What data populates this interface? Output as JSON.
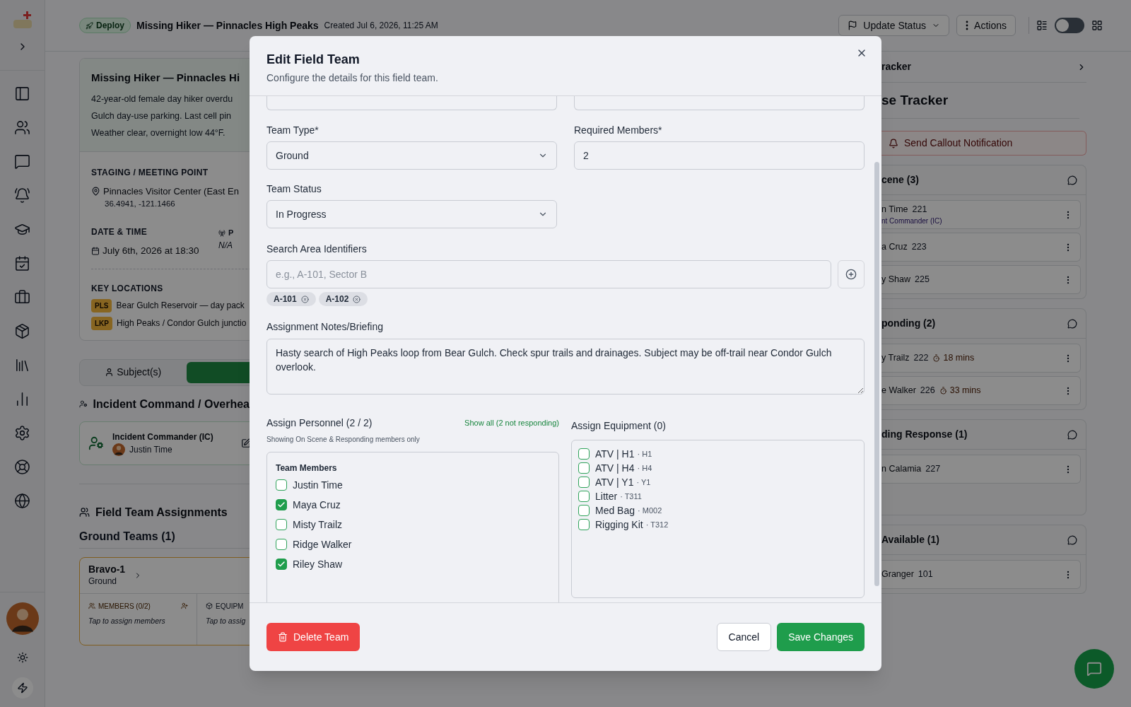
{
  "top_bar": {
    "badge": "Deploy",
    "title": "Missing Hiker — Pinnacles High Peaks",
    "created": "Created Jul 6, 2026, 11:25 AM",
    "update_status": "Update Status",
    "actions": "Actions",
    "view_toggle": {
      "on": false
    }
  },
  "incident": {
    "title": "Missing Hiker — Pinnacles Hi",
    "description_lines": [
      "42-year-old female day hiker overdu",
      "Gulch day-use parking. Last cell pin",
      "Weather clear, overnight low 44°F."
    ],
    "staging_label": "STAGING / MEETING POINT",
    "staging": "Pinnacles Visitor Center (East En",
    "coords": "36.4941, -121.1466",
    "date_label": "DATE & TIME",
    "date": "July 6th, 2026 at 18:30",
    "side_label": "P",
    "side_value": "N/A",
    "key_label": "KEY LOCATIONS",
    "locations": [
      {
        "tag": "PLS",
        "text": "Bear Gulch Reservoir — day pack"
      },
      {
        "tag": "LKP",
        "text": "High Peaks / Condor Gulch junctio"
      }
    ]
  },
  "tabs": [
    {
      "label": "Subject(s)",
      "selected": false
    },
    {
      "selected": true
    }
  ],
  "command": {
    "heading": "Incident Command / Overhea",
    "role": "Incident Commander (IC)",
    "name": "Justin Time"
  },
  "field_teams": {
    "heading": "Field Team Assignments",
    "group": "Ground Teams (1)",
    "team": {
      "name": "Bravo-1",
      "type": "Ground",
      "members_label": "MEMBERS (0/2)",
      "members_hint": "Tap to assign members",
      "equipment_label": "EQUIPM",
      "equipment_hint": "Tap to assig"
    }
  },
  "tracker": {
    "link": "racker",
    "heading": "se Tracker",
    "callout": "Send Callout Notification",
    "groups": [
      {
        "title": "cene (3)",
        "members": [
          {
            "name": "n Time",
            "number": "221",
            "role": "nt Commander (IC)"
          },
          {
            "name": "a Cruz",
            "number": "223"
          },
          {
            "name": "y Shaw",
            "number": "225"
          }
        ]
      },
      {
        "title": "ponding (2)",
        "members": [
          {
            "name": "y Trailz",
            "number": "222",
            "eta": "18 mins"
          },
          {
            "name": "e Walker",
            "number": "226",
            "eta": "33 mins"
          }
        ]
      },
      {
        "title": "ding Response (1)",
        "members": [
          {
            "name": "n Calamia",
            "number": "227"
          }
        ]
      },
      {
        "title": "Available (1)",
        "members": [
          {
            "name": "Granger",
            "number": "101"
          }
        ]
      }
    ]
  },
  "modal": {
    "title": "Edit Field Team",
    "subtitle": "Configure the details for this field team.",
    "team_type": {
      "label": "Team Type*",
      "value": "Ground"
    },
    "required_members": {
      "label": "Required Members*",
      "value": "2"
    },
    "team_status": {
      "label": "Team Status",
      "value": "In Progress"
    },
    "search_area": {
      "label": "Search Area Identifiers",
      "placeholder": "e.g., A-101, Sector B",
      "tags": [
        "A-101",
        "A-102"
      ]
    },
    "notes": {
      "label": "Assignment Notes/Briefing",
      "value": "Hasty search of High Peaks loop from Bear Gulch. Check spur trails and drainages. Subject may be off-trail near Condor Gulch overlook."
    },
    "personnel": {
      "label": "Assign Personnel (2 / 2)",
      "show_all": "Show all (2 not responding)",
      "hint": "Showing On Scene & Responding members only",
      "group": "Team Members",
      "members": [
        {
          "name": "Justin Time",
          "checked": false
        },
        {
          "name": "Maya Cruz",
          "checked": true
        },
        {
          "name": "Misty Trailz",
          "checked": false
        },
        {
          "name": "Ridge Walker",
          "checked": false
        },
        {
          "name": "Riley Shaw",
          "checked": true
        }
      ]
    },
    "equipment": {
      "label": "Assign Equipment (0)",
      "items": [
        {
          "name": "ATV | H1",
          "code": "· H1",
          "checked": false
        },
        {
          "name": "ATV | H4",
          "code": "· H4",
          "checked": false
        },
        {
          "name": "ATV | Y1",
          "code": "· Y1",
          "checked": false
        },
        {
          "name": "Litter",
          "code": "· T311",
          "checked": false
        },
        {
          "name": "Med Bag",
          "code": "· M002",
          "checked": false
        },
        {
          "name": "Rigging Kit",
          "code": "· T312",
          "checked": false
        }
      ]
    },
    "footer": {
      "delete": "Delete Team",
      "cancel": "Cancel",
      "save": "Save Changes"
    }
  }
}
